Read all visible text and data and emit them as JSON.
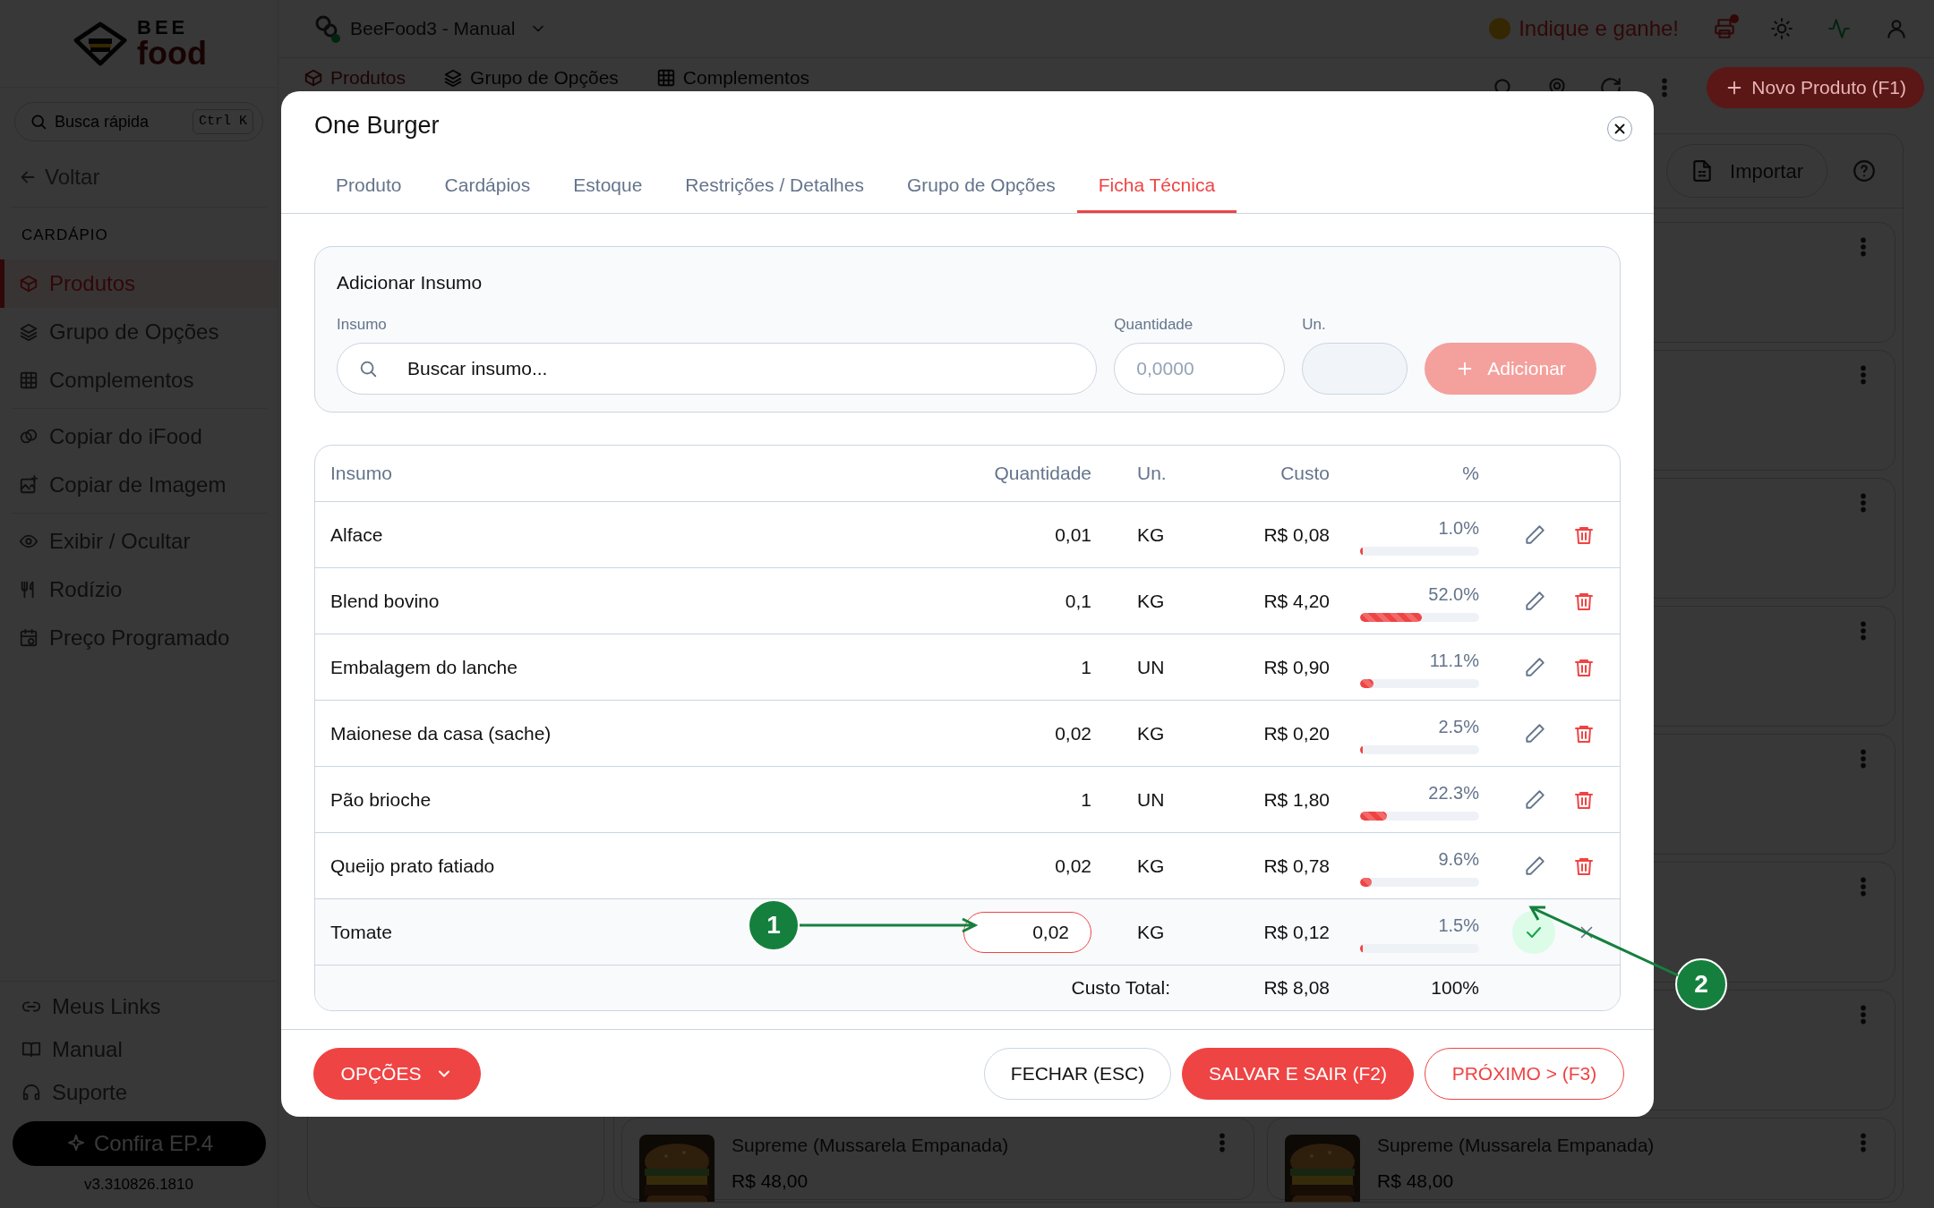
{
  "sidebar": {
    "logo": {
      "word_1": "BEE",
      "word_2": "food"
    },
    "search": {
      "placeholder": "Busca rápida",
      "shortcut": "Ctrl K"
    },
    "back": "Voltar",
    "section": "CARDÁPIO",
    "groups": [
      [
        {
          "label": "Produtos",
          "selected": true
        },
        {
          "label": "Grupo de Opções",
          "selected": false
        },
        {
          "label": "Complementos",
          "selected": false
        }
      ],
      [
        {
          "label": "Copiar do iFood",
          "selected": false
        },
        {
          "label": "Copiar de Imagem",
          "selected": false
        }
      ],
      [
        {
          "label": "Exibir / Ocultar",
          "selected": false
        },
        {
          "label": "Rodízio",
          "selected": false
        },
        {
          "label": "Preço Programado",
          "selected": false
        }
      ]
    ],
    "bottom_links": [
      {
        "label": "Meus Links"
      },
      {
        "label": "Manual"
      },
      {
        "label": "Suporte"
      }
    ],
    "promo_button": "Confira EP.4",
    "version": "v3.310826.1810"
  },
  "topbar": {
    "workspace": "BeeFood3 - Manual",
    "referral": "Indique e ganhe!"
  },
  "subbar": {
    "tabs": [
      {
        "label": "Produtos",
        "selected": true
      },
      {
        "label": "Grupo de Opções",
        "selected": false
      },
      {
        "label": "Complementos",
        "selected": false
      }
    ],
    "new_button": "Novo Produto (F1)"
  },
  "toolbar": {
    "import_button": "Importar"
  },
  "product_cards": [
    {
      "name": "Supreme (Mussarela Empanada)",
      "price": "R$ 48,00"
    },
    {
      "name": "Supreme (Mussarela Empanada)",
      "price": "R$ 48,00"
    }
  ],
  "modal": {
    "title": "One Burger",
    "tabs": [
      {
        "label": "Produto",
        "selected": false
      },
      {
        "label": "Cardápios",
        "selected": false
      },
      {
        "label": "Estoque",
        "selected": false
      },
      {
        "label": "Restrições / Detalhes",
        "selected": false
      },
      {
        "label": "Grupo de Opções",
        "selected": false
      },
      {
        "label": "Ficha Técnica",
        "selected": true
      }
    ],
    "add_form": {
      "title": "Adicionar Insumo",
      "insumo_label": "Insumo",
      "insumo_placeholder": "Buscar insumo...",
      "quantity_label": "Quantidade",
      "quantity_placeholder": "0,0000",
      "unit_label": "Un.",
      "add_button": "Adicionar",
      "add_disabled": true
    },
    "table": {
      "columns": [
        "Insumo",
        "Quantidade",
        "Un.",
        "Custo",
        "%"
      ],
      "rows": [
        {
          "insumo": "Alface",
          "quantity": "0,01",
          "unit": "KG",
          "cost": "R$ 0,08",
          "percent": "1.0%",
          "level": 0.01,
          "editing": false
        },
        {
          "insumo": "Blend bovino",
          "quantity": "0,1",
          "unit": "KG",
          "cost": "R$ 4,20",
          "percent": "52.0%",
          "level": 0.52,
          "editing": false
        },
        {
          "insumo": "Embalagem do lanche",
          "quantity": "1",
          "unit": "UN",
          "cost": "R$ 0,90",
          "percent": "11.1%",
          "level": 0.111,
          "editing": false
        },
        {
          "insumo": "Maionese da casa (sache)",
          "quantity": "0,02",
          "unit": "KG",
          "cost": "R$ 0,20",
          "percent": "2.5%",
          "level": 0.025,
          "editing": false
        },
        {
          "insumo": "Pão brioche",
          "quantity": "1",
          "unit": "UN",
          "cost": "R$ 1,80",
          "percent": "22.3%",
          "level": 0.223,
          "editing": false
        },
        {
          "insumo": "Queijo prato fatiado",
          "quantity": "0,02",
          "unit": "KG",
          "cost": "R$ 0,78",
          "percent": "9.6%",
          "level": 0.096,
          "editing": false
        },
        {
          "insumo": "Tomate",
          "quantity": "0,02",
          "unit": "KG",
          "cost": "R$ 0,12",
          "percent": "1.5%",
          "level": 0.015,
          "editing": true
        }
      ],
      "total": {
        "label": "Custo Total:",
        "cost": "R$ 8,08",
        "percent": "100%"
      }
    },
    "footer": {
      "options_button": "OPÇÕES",
      "close_button": "FECHAR (ESC)",
      "save_button": "SALVAR E SAIR (F2)",
      "next_button": "PRÓXIMO > (F3)"
    }
  },
  "annotations": [
    {
      "label": "1"
    },
    {
      "label": "2"
    }
  ]
}
